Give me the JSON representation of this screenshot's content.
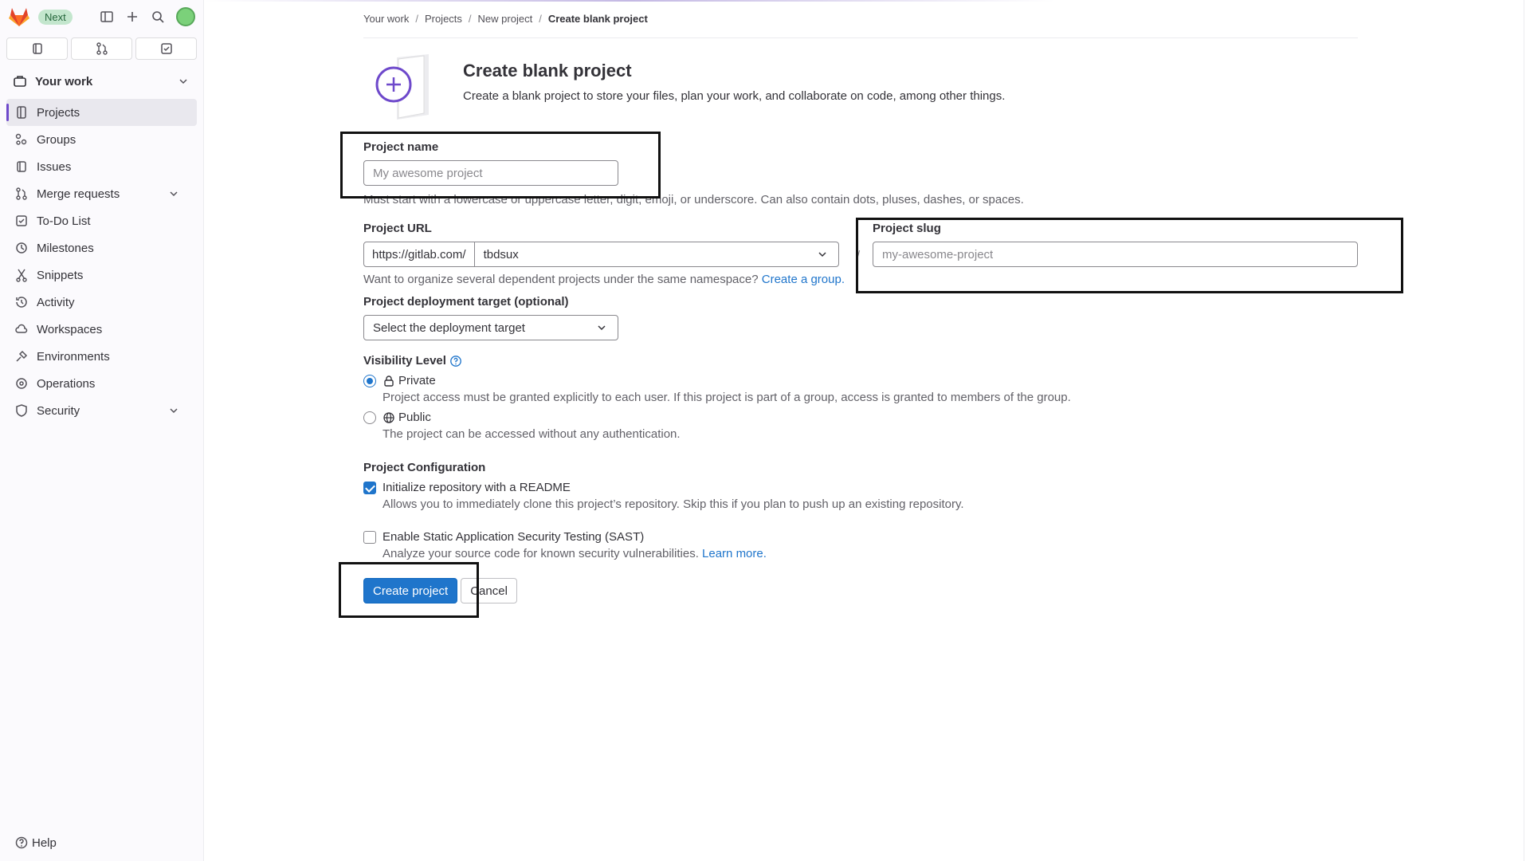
{
  "sidebar": {
    "badge": "Next",
    "context": "Your work",
    "items": [
      {
        "label": "Projects",
        "icon": "project-icon"
      },
      {
        "label": "Groups",
        "icon": "group-icon"
      },
      {
        "label": "Issues",
        "icon": "issues-icon"
      },
      {
        "label": "Merge requests",
        "icon": "merge-request-icon"
      },
      {
        "label": "To-Do List",
        "icon": "todo-icon"
      },
      {
        "label": "Milestones",
        "icon": "milestone-icon"
      },
      {
        "label": "Snippets",
        "icon": "snippet-icon"
      },
      {
        "label": "Activity",
        "icon": "history-icon"
      },
      {
        "label": "Workspaces",
        "icon": "cloud-icon"
      },
      {
        "label": "Environments",
        "icon": "environment-icon"
      },
      {
        "label": "Operations",
        "icon": "deployments-icon"
      },
      {
        "label": "Security",
        "icon": "shield-icon"
      }
    ],
    "help": "Help"
  },
  "breadcrumb": [
    "Your work",
    "Projects",
    "New project",
    "Create blank project"
  ],
  "header": {
    "title": "Create blank project",
    "description": "Create a blank project to store your files, plan your work, and collaborate on code, among other things."
  },
  "form": {
    "name_label": "Project name",
    "name_placeholder": "My awesome project",
    "name_help": "Must start with a lowercase or uppercase letter, digit, emoji, or underscore. Can also contain dots, pluses, dashes, or spaces.",
    "url_label": "Project URL",
    "url_prefix": "https://gitlab.com/",
    "namespace": "tbdsux",
    "slash": "/",
    "slug_label": "Project slug",
    "slug_placeholder": "my-awesome-project",
    "url_help": "Want to organize several dependent projects under the same namespace?",
    "url_help_link": "Create a group.",
    "deploy_label": "Project deployment target (optional)",
    "deploy_value": "Select the deployment target",
    "visibility_label": "Visibility Level",
    "private_label": "Private",
    "private_help": "Project access must be granted explicitly to each user. If this project is part of a group, access is granted to members of the group.",
    "public_label": "Public",
    "public_help": "The project can be accessed without any authentication.",
    "config_label": "Project Configuration",
    "readme_label": "Initialize repository with a README",
    "readme_help": "Allows you to immediately clone this project’s repository. Skip this if you plan to push up an existing repository.",
    "sast_label": "Enable Static Application Security Testing (SAST)",
    "sast_help": "Analyze your source code for known security vulnerabilities.",
    "sast_link": "Learn more.",
    "create_button": "Create project",
    "cancel_button": "Cancel"
  },
  "colors": {
    "accent": "#1f75cb",
    "sidebar_active": "#6e49cb"
  }
}
